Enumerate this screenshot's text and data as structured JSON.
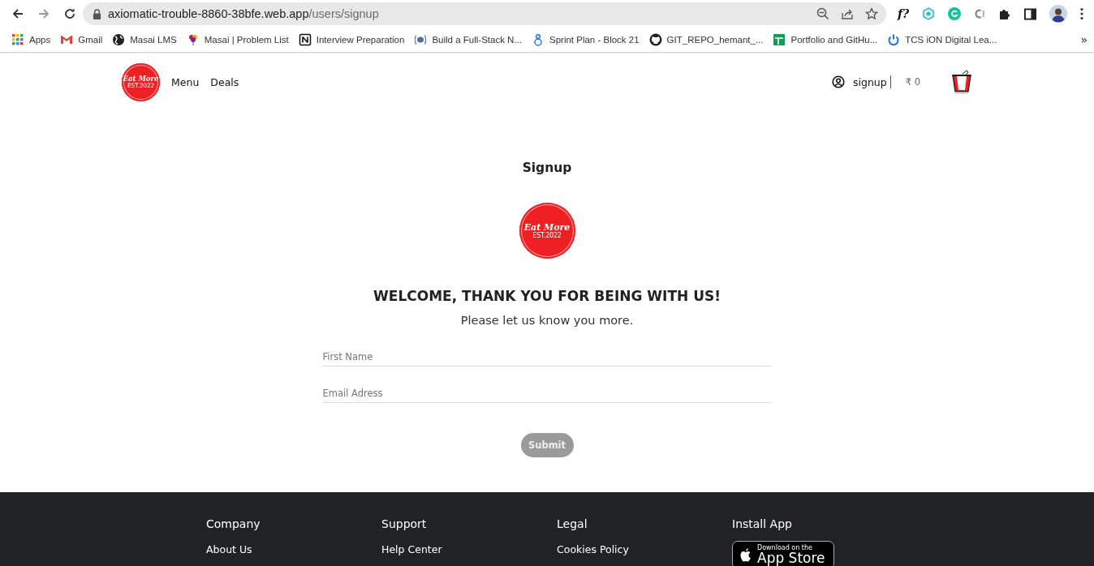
{
  "browser": {
    "url_host": "axiomatic-trouble-8860-38bfe.web.app",
    "url_path": "/users/signup",
    "extension_text": "f?",
    "bookmarks": [
      {
        "label": "Apps"
      },
      {
        "label": "Gmail"
      },
      {
        "label": "Masai LMS"
      },
      {
        "label": "Masai | Problem List"
      },
      {
        "label": "Interview Preparation"
      },
      {
        "label": "Build a Full-Stack N..."
      },
      {
        "label": "Sprint Plan - Block 21"
      },
      {
        "label": "GIT_REPO_hemant_..."
      },
      {
        "label": "Portfolio and GitHu..."
      },
      {
        "label": "TCS iON Digital Lea..."
      }
    ],
    "overflow": "»"
  },
  "header": {
    "logo": {
      "name": "Eat More",
      "est": "EST.2022"
    },
    "nav": [
      "Menu",
      "Deals"
    ],
    "account": "signup",
    "cart_total": "₹ 0"
  },
  "signup": {
    "title": "Signup",
    "logo": {
      "name": "Eat More",
      "est": "EST.2022"
    },
    "heading": "WELCOME, THANK YOU FOR BEING WITH US!",
    "subtitle": "Please let us know you more.",
    "fields": [
      {
        "placeholder": "First Name"
      },
      {
        "placeholder": "Email Adress"
      }
    ],
    "submit": {
      "label": "Submit",
      "disabled": true
    }
  },
  "footer": {
    "columns": [
      {
        "heading": "Company",
        "links": [
          "About Us"
        ]
      },
      {
        "heading": "Support",
        "links": [
          "Help Center"
        ]
      },
      {
        "heading": "Legal",
        "links": [
          "Cookies Policy"
        ]
      },
      {
        "heading": "Install App",
        "badge": {
          "small": "Download on the",
          "big": "App Store"
        }
      }
    ]
  }
}
